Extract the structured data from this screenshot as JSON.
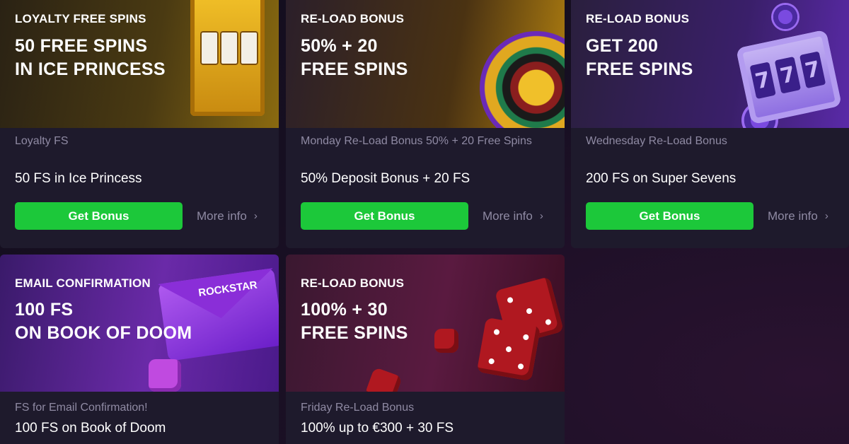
{
  "cards": [
    {
      "eyebrow": "LOYALTY FREE SPINS",
      "headline_1": "50 FREE SPINS",
      "headline_2": "IN ICE PRINCESS",
      "subtitle": "Loyalty FS",
      "offer": "50 FS in Ice Princess",
      "button": "Get Bonus",
      "more_info": "More info"
    },
    {
      "eyebrow": "RE-LOAD BONUS",
      "headline_1": "50% + 20",
      "headline_2": "FREE SPINS",
      "subtitle": "Monday Re-Load Bonus 50% + 20 Free Spins",
      "offer": "50% Deposit Bonus + 20 FS",
      "button": "Get Bonus",
      "more_info": "More info"
    },
    {
      "eyebrow": "RE-LOAD BONUS",
      "headline_1": "GET 200",
      "headline_2": "FREE SPINS",
      "subtitle": "Wednesday Re-Load Bonus",
      "offer": "200 FS on Super Sevens",
      "button": "Get Bonus",
      "more_info": "More info"
    },
    {
      "eyebrow": "EMAIL CONFIRMATION",
      "headline_1": "100 FS",
      "headline_2": "ON BOOK OF DOOM",
      "subtitle": "FS for Email Confirmation!",
      "offer": "100 FS on Book of Doom",
      "envelope_brand": "ROCKSTAR"
    },
    {
      "eyebrow": "RE-LOAD BONUS",
      "headline_1": "100% + 30",
      "headline_2": "FREE SPINS",
      "subtitle": "Friday Re-Load Bonus",
      "offer": "100% up to €300 + 30 FS"
    }
  ],
  "slot_symbols": [
    "7",
    "7",
    "7"
  ],
  "icons": {
    "more_info": "chevron-right-icon"
  },
  "colors": {
    "button_green": "#1cc83a",
    "card_bg": "#1e1a2c",
    "muted_text": "#8f8aa3"
  }
}
